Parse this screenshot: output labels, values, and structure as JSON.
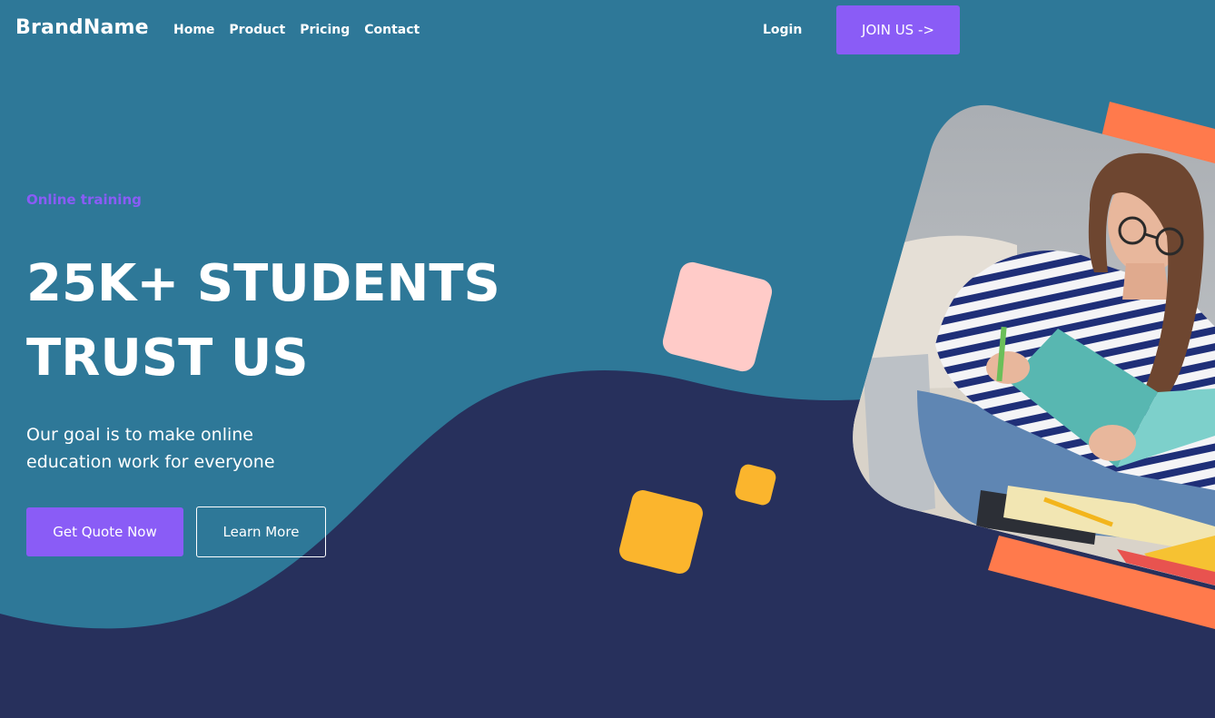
{
  "colors": {
    "hero_bg": "#2e7898",
    "wave_dark": "#27305c",
    "accent_purple": "#8a5cf6",
    "orange": "#ff7a4c",
    "pink": "#ffcbc8",
    "yellow": "#fbb52d"
  },
  "nav": {
    "brand": "BrandName",
    "links": [
      "Home",
      "Product",
      "Pricing",
      "Contact"
    ],
    "login": "Login",
    "join": "JOIN US ->"
  },
  "hero": {
    "eyebrow": "Online training",
    "headline_line1": "25K+ STUDENTS",
    "headline_line2": "TRUST US",
    "subtitle_line1": "Our goal is to make online",
    "subtitle_line2": "education work for everyone",
    "primary_button": "Get Quote Now",
    "secondary_button": "Learn More"
  },
  "image": {
    "subject": "student-reading-photo"
  }
}
